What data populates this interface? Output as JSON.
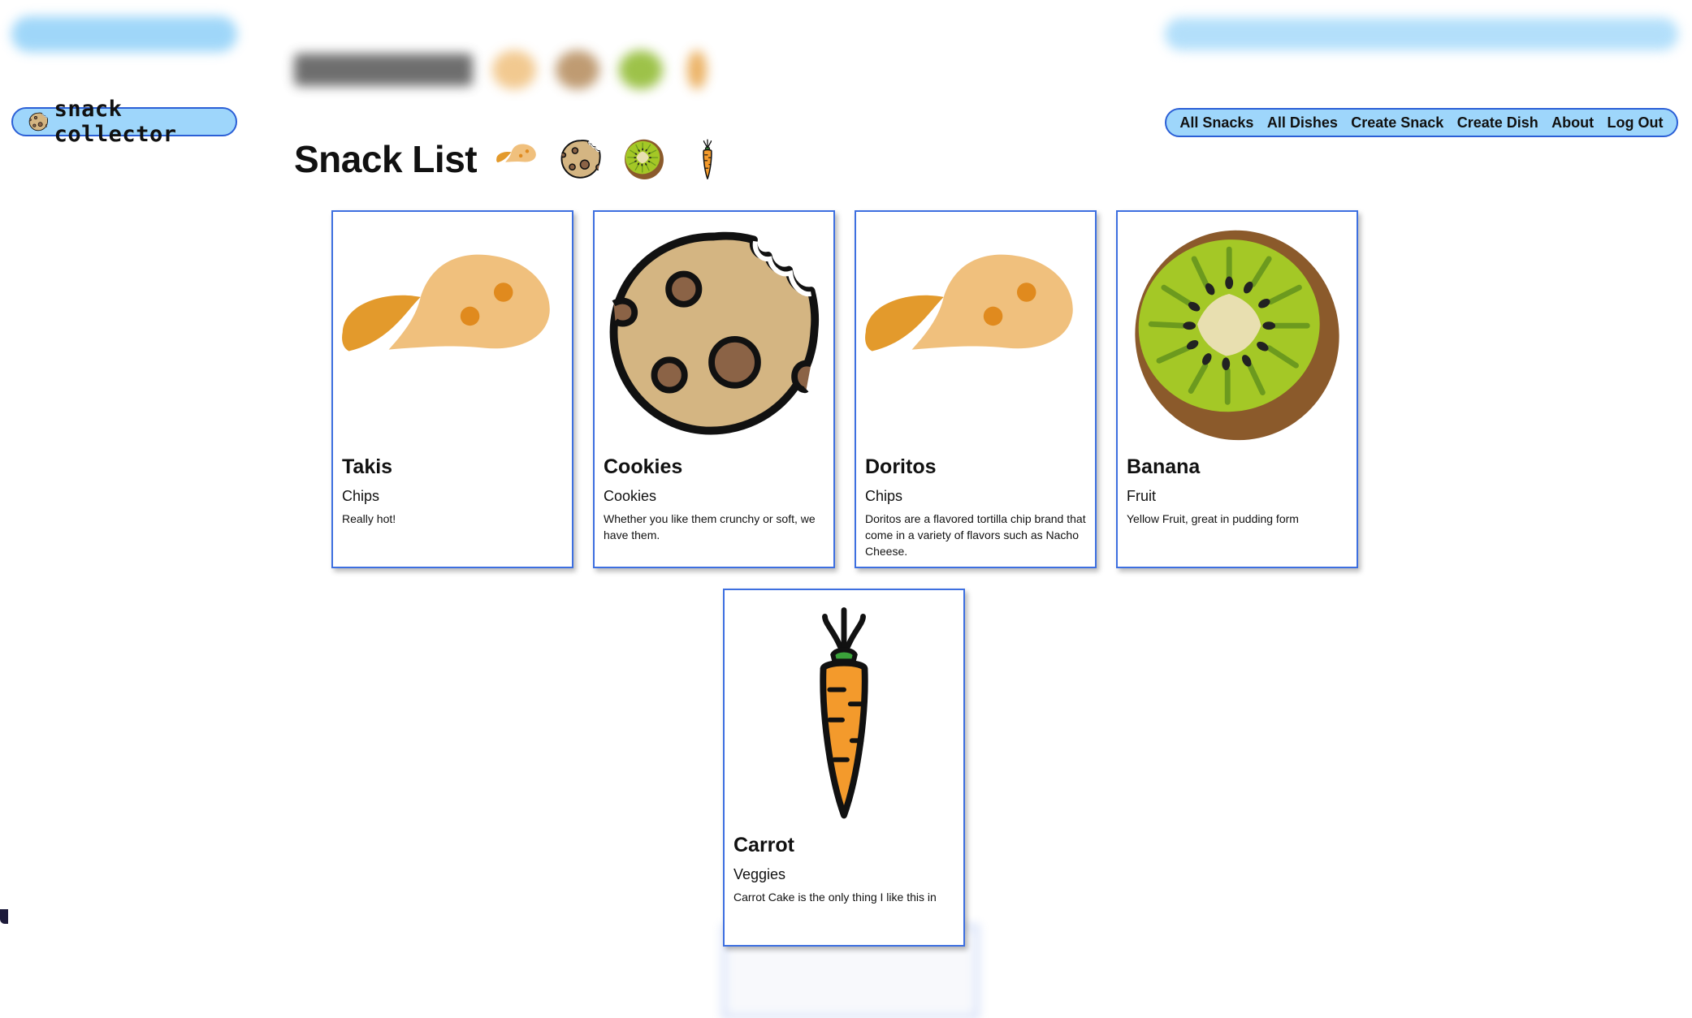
{
  "app": {
    "logo_text": "snack collector",
    "logo_icon": "cookie-icon"
  },
  "nav": {
    "items": [
      "All Snacks",
      "All Dishes",
      "Create Snack",
      "Create Dish",
      "About",
      "Log Out"
    ]
  },
  "page": {
    "title": "Snack List",
    "title_icons": [
      "chip-icon",
      "cookie-icon",
      "kiwi-icon",
      "carrot-icon"
    ]
  },
  "snacks": [
    {
      "name": "Takis",
      "type": "Chips",
      "description": "Really hot!",
      "icon": "chip-icon"
    },
    {
      "name": "Cookies",
      "type": "Cookies",
      "description": "Whether you like them crunchy or soft, we have them.",
      "icon": "cookie-icon"
    },
    {
      "name": "Doritos",
      "type": "Chips",
      "description": "Doritos are a flavored tortilla chip brand that come in a variety of flavors such as Nacho Cheese.",
      "icon": "chip-icon"
    },
    {
      "name": "Banana",
      "type": "Fruit",
      "description": "Yellow Fruit, great in pudding form",
      "icon": "kiwi-icon"
    },
    {
      "name": "Carrot",
      "type": "Veggies",
      "description": "Carrot Cake is the only thing I like this in",
      "icon": "carrot-icon"
    }
  ],
  "colors": {
    "pill_bg": "#9ed6fb",
    "pill_border": "#2b5fd6",
    "card_border": "#3d6fe0"
  }
}
